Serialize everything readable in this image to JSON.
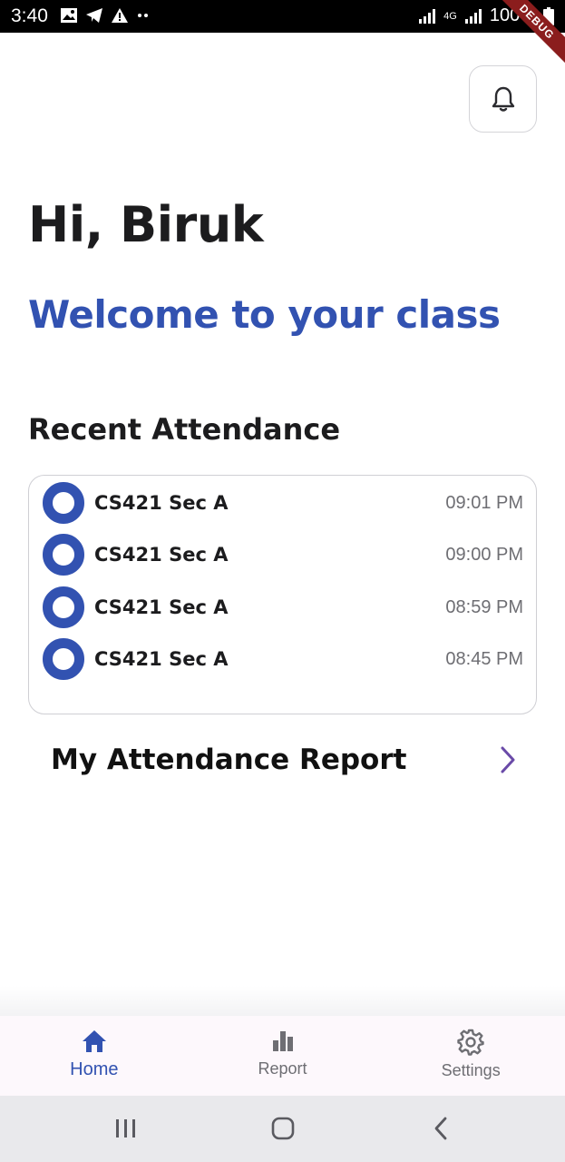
{
  "status_bar": {
    "time": "3:40",
    "battery": "100%",
    "network": "4G",
    "debug_banner": "DEBUG"
  },
  "header": {
    "greeting": "Hi, Biruk",
    "subtitle": "Welcome to your class"
  },
  "recent_attendance": {
    "title": "Recent Attendance",
    "items": [
      {
        "course": "CS421 Sec A",
        "time": "09:01 PM"
      },
      {
        "course": "CS421 Sec A",
        "time": "09:00 PM"
      },
      {
        "course": "CS421 Sec A",
        "time": "08:59 PM"
      },
      {
        "course": "CS421 Sec A",
        "time": "08:45 PM"
      }
    ]
  },
  "report_link": {
    "label": "My Attendance Report"
  },
  "bottom_nav": {
    "items": [
      {
        "label": "Home",
        "icon": "home-icon",
        "active": true
      },
      {
        "label": "Report",
        "icon": "bar-chart-icon",
        "active": false
      },
      {
        "label": "Settings",
        "icon": "gear-icon",
        "active": false
      }
    ]
  },
  "colors": {
    "accent": "#3252b1",
    "text": "#1c1c1e",
    "muted": "#6e6e73",
    "chevron": "#6a4aa8"
  }
}
